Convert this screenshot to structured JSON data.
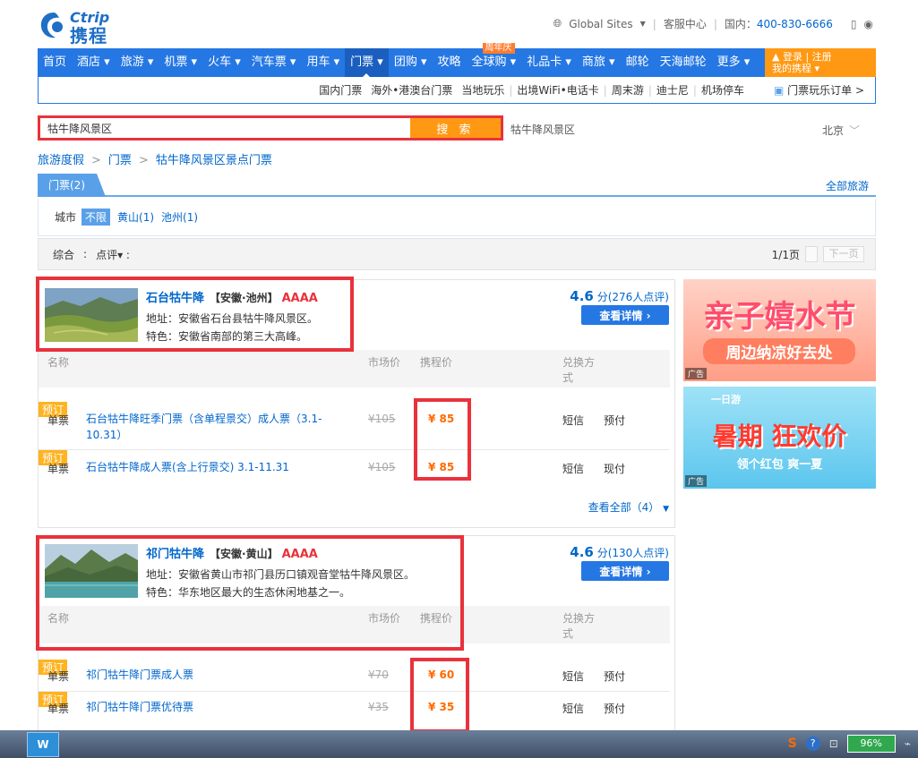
{
  "header": {
    "logo_en": "Ctrip",
    "logo_cn": "携程",
    "global_sites": "Global Sites",
    "service_center": "客服中心",
    "domestic_label": "国内：",
    "phone": "400-830-6666"
  },
  "nav": {
    "items": [
      "首页",
      "酒店",
      "旅游",
      "机票",
      "火车",
      "汽车票",
      "用车",
      "门票",
      "团购",
      "攻略",
      "全球购",
      "礼品卡",
      "商旅",
      "邮轮",
      "天海邮轮",
      "更多"
    ],
    "anniversary_badge": "周年庆",
    "login": "登录 | 注册",
    "my_ctrip": "我的携程"
  },
  "subnav": {
    "items": [
      "国内门票",
      "海外•港澳台门票",
      "当地玩乐",
      "出境WiFi•电话卡",
      "周末游",
      "迪士尼",
      "机场停车"
    ],
    "orders": "门票玩乐订单 >"
  },
  "search": {
    "value": "牯牛降风景区",
    "button": "搜 索",
    "hint": "牯牛降风景区",
    "city": "北京"
  },
  "breadcrumb": {
    "level1": "旅游度假",
    "level2": "门票",
    "level3": "牯牛降风景区景点门票"
  },
  "tabs": {
    "tickets": "门票(2)",
    "all_travel": "全部旅游"
  },
  "filter": {
    "label": "城市",
    "unlimited": "不限",
    "options": [
      "黄山(1)",
      "池州(1)"
    ]
  },
  "sort": {
    "composite": "综合",
    "reviews": "点评",
    "page_info": "1/1页",
    "next": "下一页"
  },
  "table_headers": {
    "name": "名称",
    "market_price": "市场价",
    "ctrip_price": "携程价",
    "exchange_line1": "兑换方",
    "exchange_line2": "式"
  },
  "spots": [
    {
      "name": "石台牯牛降",
      "region": "【安徽·池州】",
      "level": "AAAA",
      "address": "地址：安徽省石台县牯牛降风景区。",
      "feature": "特色：安徽省南部的第三大高峰。",
      "score": "4.6",
      "score_unit": "分",
      "reviews": "(276人点评)",
      "detail": "查看详情",
      "tickets": [
        {
          "type": "单票",
          "title": "石台牯牛降旺季门票（含单程景交）成人票（3.1-10.31）",
          "market": "¥105",
          "price": "¥ 85",
          "sms": "短信",
          "pay": "预付",
          "book": "预订"
        },
        {
          "type": "单票",
          "title": "石台牯牛降成人票(含上行景交) 3.1-11.31",
          "market": "¥105",
          "price": "¥ 85",
          "sms": "短信",
          "pay": "现付",
          "book": "预订"
        }
      ],
      "view_all": "查看全部（4）"
    },
    {
      "name": "祁门牯牛降",
      "region": "【安徽·黄山】",
      "level": "AAAA",
      "address": "地址：安徽省黄山市祁门县历口镇观音堂牯牛降风景区。",
      "feature": "特色：华东地区最大的生态休闲地基之一。",
      "score": "4.6",
      "score_unit": "分",
      "reviews": "(130人点评)",
      "detail": "查看详情",
      "tickets": [
        {
          "type": "单票",
          "title": "祁门牯牛降门票成人票",
          "market": "¥70",
          "price": "¥ 60",
          "sms": "短信",
          "pay": "预付",
          "book": "预订"
        },
        {
          "type": "单票",
          "title": "祁门牯牛降门票优待票",
          "market": "¥35",
          "price": "¥ 35",
          "sms": "短信",
          "pay": "预付",
          "book": "预订"
        }
      ]
    }
  ],
  "ads": {
    "ad1_title": "亲子嬉水节",
    "ad1_sub": "周边纳凉好去处",
    "ad2_top": "一日游",
    "ad2_title": "暑期 狂欢价",
    "ad2_sub": "领个红包 爽一夏",
    "ad_tag": "广告"
  },
  "taskbar": {
    "battery": "96%"
  },
  "colors": {
    "brand_blue": "#2577e3",
    "highlight_red": "#e8323c",
    "price_orange": "#ff6a00",
    "book_yellow": "#ffb320"
  }
}
